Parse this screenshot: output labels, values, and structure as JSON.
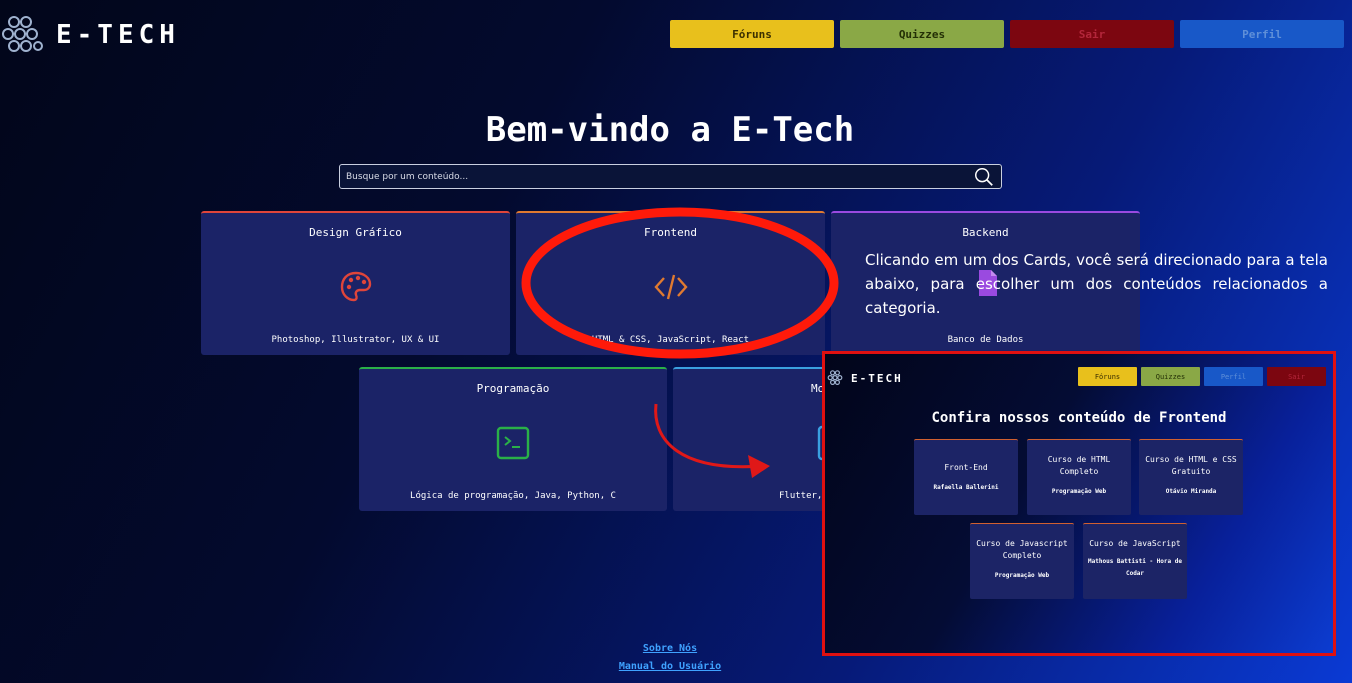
{
  "header": {
    "logo_text": "E-TECH",
    "nav": [
      {
        "label": "Fóruns",
        "color": "#e8c01c"
      },
      {
        "label": "Quizzes",
        "color": "#8aa846"
      },
      {
        "label": "Sair",
        "color": "#7c0610"
      },
      {
        "label": "Perfil",
        "color": "#1858c8"
      }
    ]
  },
  "main": {
    "title": "Bem-vindo a E-Tech",
    "search_placeholder": "Busque por um conteúdo...",
    "cards": [
      {
        "title": "Design Gráfico",
        "icon": "palette-icon",
        "description": "Photoshop, Illustrator, UX & UI",
        "accent": "#e0453a"
      },
      {
        "title": "Frontend",
        "icon": "code-icon",
        "description": "HTML & CSS, JavaScript, React",
        "accent": "#e07a30"
      },
      {
        "title": "Backend",
        "icon": "file-code-icon",
        "description": "Banco de Dados",
        "accent": "#9a4ae0"
      },
      {
        "title": "Programação",
        "icon": "terminal-icon",
        "description": "Lógica de programação, Java, Python, C",
        "accent": "#2ab048"
      },
      {
        "title": "Mo",
        "icon": "mobile-icon",
        "description": "Flutter,",
        "accent": "#3aa0e0"
      }
    ]
  },
  "annotation": {
    "text": "Clicando em um dos Cards, você será direcionado para a tela abaixo, para escolher um dos conteúdos relacionados a categoria."
  },
  "inset": {
    "logo_text": "E-TECH",
    "nav": [
      {
        "label": "Fóruns",
        "color": "#e8c01c"
      },
      {
        "label": "Quizzes",
        "color": "#8aa846"
      },
      {
        "label": "Perfil",
        "color": "#1858c8"
      },
      {
        "label": "Sair",
        "color": "#7c0610"
      }
    ],
    "title": "Confira nossos conteúdo de Frontend",
    "cards": [
      {
        "title": "Front-End",
        "author": "Rafaella Ballerini"
      },
      {
        "title": "Curso de HTML Completo",
        "author": "Programação Web"
      },
      {
        "title": "Curso de HTML e CSS Gratuito",
        "author": "Otávio Miranda"
      },
      {
        "title": "Curso de Javascript Completo",
        "author": "Programação Web"
      },
      {
        "title": "Curso de JavaScript",
        "author": "Mathous Battisti - Hora de Codar"
      }
    ]
  },
  "footer": {
    "about": "Sobre Nós",
    "manual": "Manual do Usuário"
  }
}
